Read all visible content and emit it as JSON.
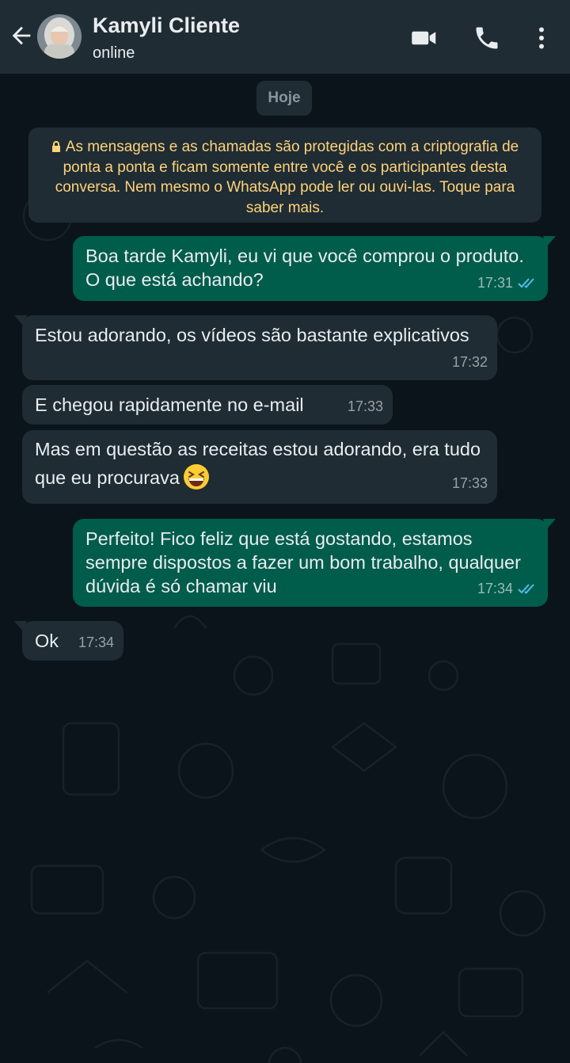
{
  "header": {
    "contact_name": "Kamyli Cliente",
    "status": "online",
    "icons": [
      "back-arrow-icon",
      "avatar",
      "video-call-icon",
      "phone-icon",
      "more-options-icon"
    ]
  },
  "chat": {
    "date_chip": "Hoje",
    "encryption_notice": "As mensagens e as chamadas são protegidas com a criptografia de ponta a ponta e ficam somente entre você e os participantes desta conversa. Nem mesmo o WhatsApp pode ler ou ouvi-las. Toque para saber mais.",
    "messages": [
      {
        "direction": "outgoing",
        "text": "Boa tarde Kamyli, eu vi que você comprou o produto. O que está achando?",
        "time": "17:31",
        "status": "read"
      },
      {
        "direction": "incoming",
        "text": "Estou adorando, os vídeos são bastante explicativos",
        "time": "17:32"
      },
      {
        "direction": "incoming",
        "text": "E chegou rapidamente no e-mail",
        "time": "17:33"
      },
      {
        "direction": "incoming",
        "text": "Mas em questão as receitas estou adorando, era tudo que eu procurava",
        "emoji": "grinning-squinting-face",
        "time": "17:33"
      },
      {
        "direction": "outgoing",
        "text": "Perfeito! Fico feliz que está gostando, estamos sempre dispostos a fazer um bom trabalho, qualquer dúvida é só chamar viu",
        "time": "17:34",
        "status": "read"
      },
      {
        "direction": "incoming",
        "text": "Ok",
        "time": "17:34"
      }
    ]
  },
  "colors": {
    "header_bg": "#1f2c34",
    "chat_bg": "#0b141a",
    "incoming_bubble": "#1f2c34",
    "outgoing_bubble": "#005c4b",
    "notice_text": "#ffd279",
    "read_ticks": "#53bdeb"
  }
}
